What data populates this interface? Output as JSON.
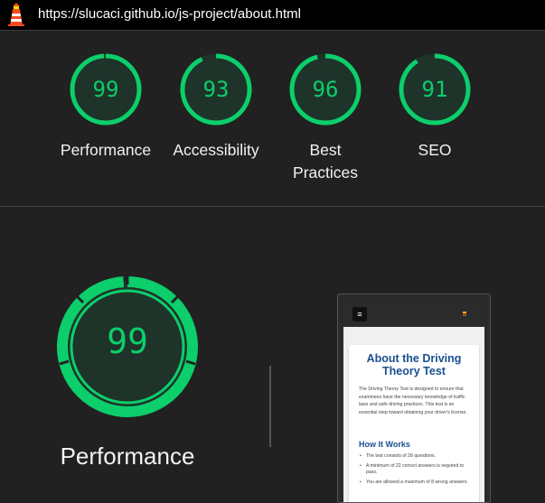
{
  "topbar": {
    "url": "https://slucaci.github.io/js-project/about.html",
    "logo_icon": "lighthouse-icon"
  },
  "colors": {
    "pass": "#0cce6b",
    "background": "#212121"
  },
  "categories": [
    {
      "label": "Performance",
      "score": "99",
      "fraction": 0.99
    },
    {
      "label": "Accessibility",
      "score": "93",
      "fraction": 0.93
    },
    {
      "label": "Best Practices",
      "score": "96",
      "fraction": 0.96
    },
    {
      "label": "SEO",
      "score": "91",
      "fraction": 0.91
    }
  ],
  "performance": {
    "score": "99",
    "label": "Performance"
  },
  "preview": {
    "menu_icon": "hamburger-menu-icon",
    "menu_glyph": "≡",
    "title": "About the Driving Theory Test",
    "intro": "The Driving Theory Test is designed to ensure that examinees have the necessary knowledge of traffic laws and safe driving practices. This test is an essential step toward obtaining your driver's license.",
    "section_heading": "How It Works",
    "bullets": [
      "The test consists of 28 questions.",
      "A minimum of 22 correct answers is required to pass.",
      "You are allowed a maximum of 8 wrong answers."
    ]
  }
}
